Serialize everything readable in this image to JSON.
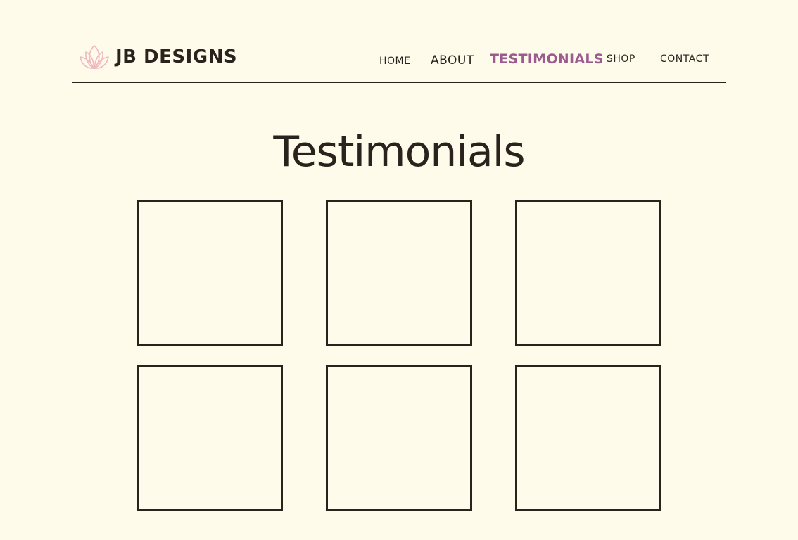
{
  "header": {
    "logo_icon": "lotus-icon",
    "brand": "JB DESIGNS",
    "accent_color": "#9b5b8e",
    "logo_color": "#f0b8c0"
  },
  "nav": {
    "items": [
      {
        "label": "HOME",
        "active": false
      },
      {
        "label": "ABOUT",
        "active": false
      },
      {
        "label": "TESTIMONIALS",
        "active": true
      },
      {
        "label": "SHOP",
        "active": false
      },
      {
        "label": "CONTACT",
        "active": false
      }
    ]
  },
  "main": {
    "title": "Testimonials",
    "cards": [
      {
        "text": ""
      },
      {
        "text": ""
      },
      {
        "text": ""
      },
      {
        "text": ""
      },
      {
        "text": ""
      },
      {
        "text": ""
      }
    ]
  },
  "colors": {
    "background": "#fffbeb",
    "text": "#2a221d"
  }
}
